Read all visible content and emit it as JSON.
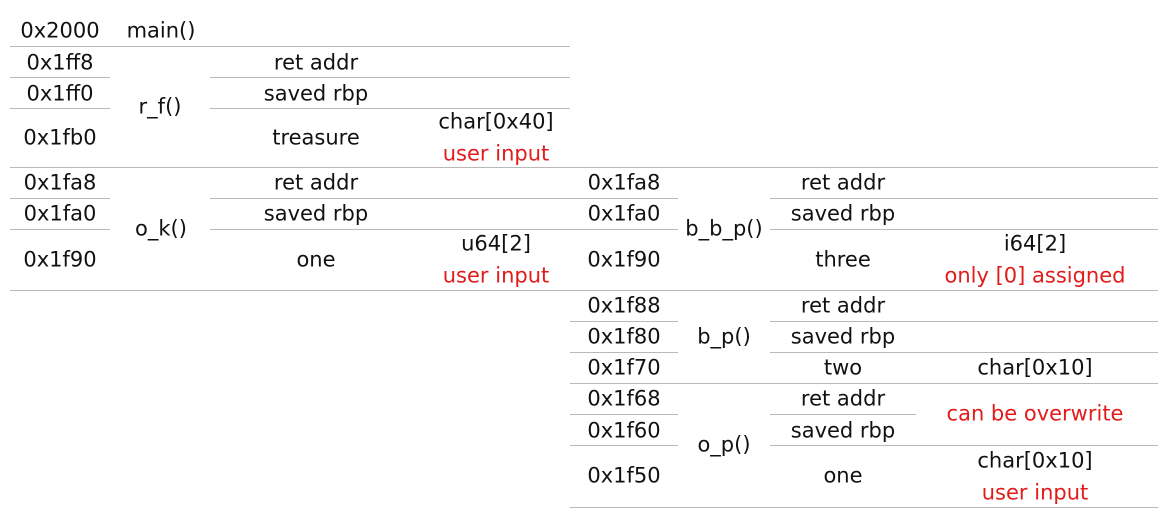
{
  "left": {
    "main": {
      "addr": "0x2000",
      "func": "main()"
    },
    "r_f": {
      "func": "r_f()",
      "rows": [
        {
          "addr": "0x1ff8",
          "name": "ret addr"
        },
        {
          "addr": "0x1ff0",
          "name": "saved rbp"
        },
        {
          "addr": "0x1fb0",
          "name": "treasure",
          "type": "char[0x40]",
          "note": "user input"
        }
      ]
    },
    "o_k": {
      "func": "o_k()",
      "rows": [
        {
          "addr": "0x1fa8",
          "name": "ret addr"
        },
        {
          "addr": "0x1fa0",
          "name": "saved rbp"
        },
        {
          "addr": "0x1f90",
          "name": "one",
          "type": "u64[2]",
          "note": "user input"
        }
      ]
    }
  },
  "right": {
    "b_b_p": {
      "func": "b_b_p()",
      "rows": [
        {
          "addr": "0x1fa8",
          "name": "ret addr"
        },
        {
          "addr": "0x1fa0",
          "name": "saved rbp"
        },
        {
          "addr": "0x1f90",
          "name": "three",
          "type": "i64[2]",
          "note": "only [0] assigned"
        }
      ]
    },
    "b_p": {
      "func": "b_p()",
      "rows": [
        {
          "addr": "0x1f88",
          "name": "ret addr"
        },
        {
          "addr": "0x1f80",
          "name": "saved rbp"
        },
        {
          "addr": "0x1f70",
          "name": "two",
          "type": "char[0x10]"
        }
      ]
    },
    "o_p": {
      "func": "o_p()",
      "note": "can be overwrite",
      "rows": [
        {
          "addr": "0x1f68",
          "name": "ret addr"
        },
        {
          "addr": "0x1f60",
          "name": "saved rbp"
        },
        {
          "addr": "0x1f50",
          "name": "one",
          "type": "char[0x10]",
          "note": "user input"
        }
      ]
    }
  },
  "colors": {
    "note": "#e21b1b",
    "rule": "#b9b9b9",
    "text": "#111111"
  }
}
